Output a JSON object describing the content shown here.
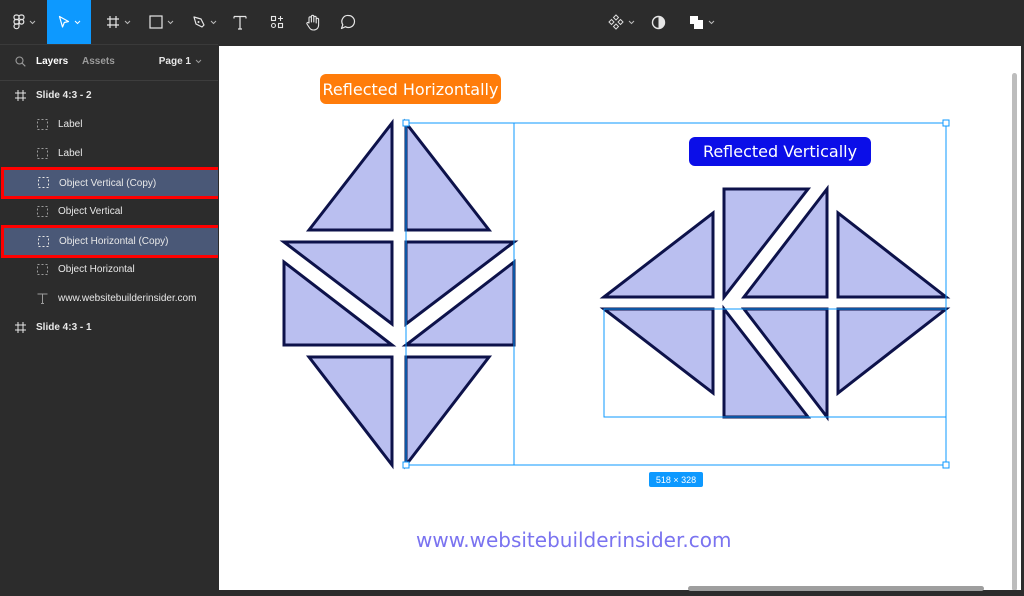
{
  "toolbar": {
    "tools": [
      {
        "name": "main-menu",
        "icon": "figma-logo-icon",
        "has_dropdown": true
      },
      {
        "name": "move-tool",
        "icon": "cursor-icon",
        "has_dropdown": true,
        "active": true
      },
      {
        "name": "frame-tool",
        "icon": "frame-icon",
        "has_dropdown": true
      },
      {
        "name": "shape-tool",
        "icon": "rectangle-icon",
        "has_dropdown": true
      },
      {
        "name": "pen-tool",
        "icon": "pen-icon",
        "has_dropdown": true
      },
      {
        "name": "text-tool",
        "icon": "text-icon",
        "has_dropdown": false
      },
      {
        "name": "resources-tool",
        "icon": "components-icon",
        "has_dropdown": false
      },
      {
        "name": "hand-tool",
        "icon": "hand-icon",
        "has_dropdown": false
      },
      {
        "name": "comment-tool",
        "icon": "comment-icon",
        "has_dropdown": false
      }
    ],
    "right_tools": [
      {
        "name": "component-tool",
        "icon": "component-icon",
        "has_dropdown": true
      },
      {
        "name": "mask-tool",
        "icon": "contrast-icon",
        "has_dropdown": false
      },
      {
        "name": "boolean-tool",
        "icon": "boolean-union-icon",
        "has_dropdown": true
      }
    ],
    "accent_color": "#0d99ff"
  },
  "sidebar": {
    "tabs": {
      "layers": "Layers",
      "assets": "Assets"
    },
    "page_selector": "Page 1",
    "layers": [
      {
        "label": "Slide 4:3 - 2",
        "type": "frame",
        "selected": false
      },
      {
        "label": "Label",
        "type": "group",
        "selected": false
      },
      {
        "label": "Label",
        "type": "group",
        "selected": false
      },
      {
        "label": "Object Vertical (Copy)",
        "type": "group",
        "selected": true
      },
      {
        "label": "Object Vertical",
        "type": "group",
        "selected": false
      },
      {
        "label": "Object Horizontal (Copy)",
        "type": "group",
        "selected": true
      },
      {
        "label": "Object Horizontal",
        "type": "group",
        "selected": false
      },
      {
        "label": "www.websitebuilderinsider.com",
        "type": "text",
        "selected": false
      },
      {
        "label": "Slide 4:3 - 1",
        "type": "frame",
        "selected": false
      }
    ]
  },
  "canvas": {
    "label_horizontal": "Reflected Horizontally",
    "label_vertical": "Reflected Vertically",
    "selection_size": "518 × 328",
    "footer_text": "www.websitebuilderinsider.com",
    "colors": {
      "label_horizontal_bg": "#ff7c0a",
      "label_vertical_bg": "#0b0ee8",
      "shape_fill": "#babff0",
      "shape_stroke": "#0d124a",
      "selection": "#0d99ff",
      "footer_text": "#7a73f0",
      "highlight_box": "#ff0000"
    }
  }
}
